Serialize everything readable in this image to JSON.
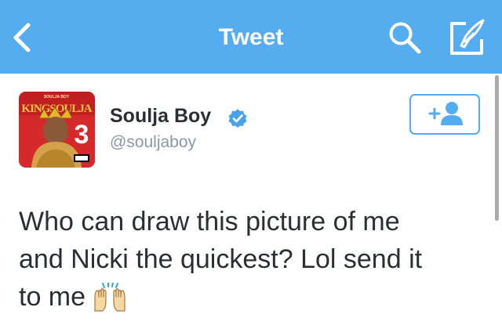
{
  "header": {
    "title": "Tweet",
    "back_icon": "chevron-left-icon",
    "search_icon": "search-icon",
    "compose_icon": "compose-tweet-icon",
    "background_color": "#55acee"
  },
  "author": {
    "display_name": "Soulja Boy",
    "handle": "@souljaboy",
    "verified": true,
    "avatar_art_text": "KING SOULJA 3",
    "follow_icon": "follow-user-icon"
  },
  "tweet": {
    "text_line_1": "Who can draw this picture of me",
    "text_line_2": "and Nicki the quickest? Lol send it",
    "text_line_3": "to me",
    "emoji": "raising-hands-emoji"
  },
  "colors": {
    "accent": "#55acee",
    "text": "#292f33",
    "secondary_text": "#8899a6"
  }
}
